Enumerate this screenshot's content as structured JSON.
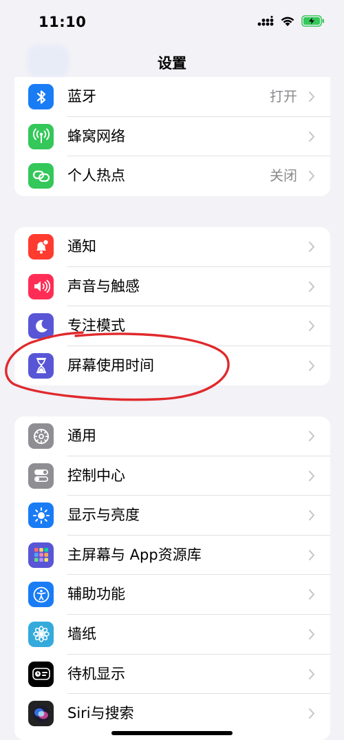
{
  "status": {
    "time": "11:10"
  },
  "nav": {
    "title": "设置"
  },
  "group1": [
    {
      "label": "蓝牙",
      "value": "打开",
      "icon": "bluetooth-icon",
      "color": "#1a7cf5"
    },
    {
      "label": "蜂窝网络",
      "value": "",
      "icon": "antenna-icon",
      "color": "#34c759"
    },
    {
      "label": "个人热点",
      "value": "关闭",
      "icon": "link-icon",
      "color": "#34c759"
    }
  ],
  "group2": [
    {
      "label": "通知",
      "icon": "bell-icon",
      "color": "#ff3b30"
    },
    {
      "label": "声音与触感",
      "icon": "speaker-icon",
      "color": "#ff2d55"
    },
    {
      "label": "专注模式",
      "icon": "moon-icon",
      "color": "#5856d6"
    },
    {
      "label": "屏幕使用时间",
      "icon": "hourglass-icon",
      "color": "#5856d6"
    }
  ],
  "group3": [
    {
      "label": "通用",
      "icon": "gear-icon",
      "color": "#8e8e93"
    },
    {
      "label": "控制中心",
      "icon": "toggles-icon",
      "color": "#8e8e93"
    },
    {
      "label": "显示与亮度",
      "icon": "sun-icon",
      "color": "#1a7cf5"
    },
    {
      "label": "主屏幕与 App资源库",
      "icon": "app-grid-icon",
      "color": "#5856d6"
    },
    {
      "label": "辅助功能",
      "icon": "accessibility-icon",
      "color": "#1a7cf5"
    },
    {
      "label": "墙纸",
      "icon": "flower-icon",
      "color": "#34aadc"
    },
    {
      "label": "待机显示",
      "icon": "standby-icon",
      "color": "#000000"
    },
    {
      "label": "Siri与搜索",
      "icon": "siri-icon",
      "color": "#222222"
    }
  ],
  "annotation_color": "#e0292c"
}
